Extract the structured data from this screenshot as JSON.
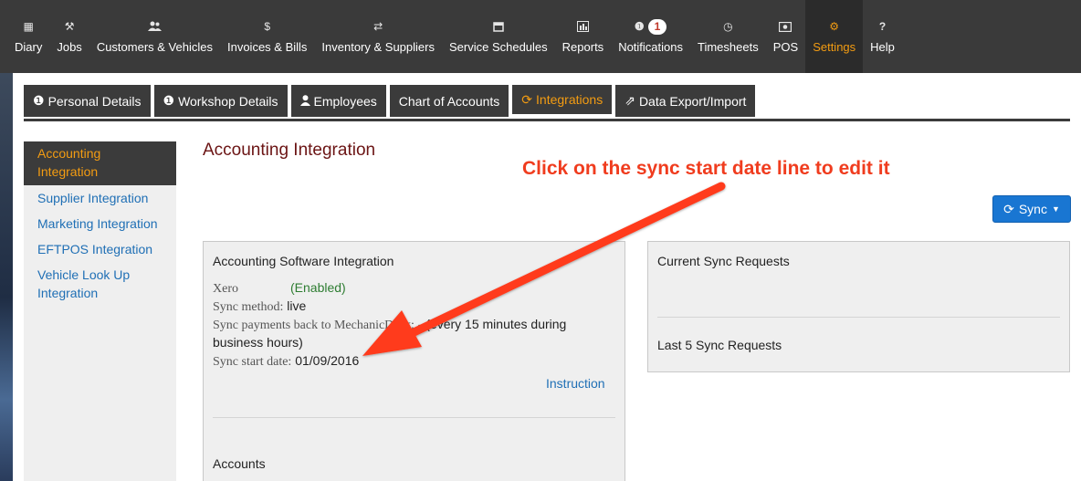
{
  "nav": {
    "items": [
      {
        "icon": "calendar-icon",
        "glyph": "▦",
        "label": "Diary"
      },
      {
        "icon": "wrench-icon",
        "glyph": "⚒",
        "label": "Jobs"
      },
      {
        "icon": "users-icon",
        "glyph": "👥",
        "label": "Customers & Vehicles"
      },
      {
        "icon": "dollar-icon",
        "glyph": "$",
        "label": "Invoices & Bills"
      },
      {
        "icon": "retweet-icon",
        "glyph": "⇄",
        "label": "Inventory & Suppliers"
      },
      {
        "icon": "calendar-blank-icon",
        "glyph": "▢",
        "label": "Service Schedules"
      },
      {
        "icon": "bar-chart-icon",
        "glyph": "▥",
        "label": "Reports"
      },
      {
        "icon": "info-icon",
        "glyph": "❶",
        "label": "Notifications",
        "badge": "1"
      },
      {
        "icon": "clock-icon",
        "glyph": "◷",
        "label": "Timesheets"
      },
      {
        "icon": "money-icon",
        "glyph": "▣",
        "label": "POS"
      },
      {
        "icon": "cogs-icon",
        "glyph": "⚙",
        "label": "Settings"
      },
      {
        "icon": "question-icon",
        "glyph": "?",
        "label": "Help"
      }
    ],
    "active": "Settings",
    "active_color": "#f39c12"
  },
  "tabs": [
    {
      "icon": "info-circle-icon",
      "glyph": "❶",
      "label": "Personal Details"
    },
    {
      "icon": "info-circle-icon",
      "glyph": "❶",
      "label": "Workshop Details"
    },
    {
      "icon": "user-icon",
      "glyph": "●",
      "label": "Employees"
    },
    {
      "icon": "",
      "glyph": "",
      "label": "Chart of Accounts"
    },
    {
      "icon": "refresh-icon",
      "glyph": "⟳",
      "label": "Integrations"
    },
    {
      "icon": "external-link-icon",
      "glyph": "⇗",
      "label": "Data Export/Import"
    }
  ],
  "side": {
    "items": [
      {
        "label": "Accounting Integration"
      },
      {
        "label": "Supplier Integration"
      },
      {
        "label": "Marketing Integration"
      },
      {
        "label": "EFTPOS Integration"
      },
      {
        "label": "Vehicle Look Up Integration"
      }
    ]
  },
  "main": {
    "title": "Accounting Integration",
    "sync_label": "Sync",
    "left_panel": {
      "title": "Accounting Software Integration",
      "provider": "Xero",
      "provider_status": "(Enabled)",
      "sync_method_label": "Sync method:",
      "sync_method_value": "live",
      "sync_payments_label": "Sync payments back to MechanicDesk:",
      "sync_payments_value": "- (every 15 minutes during",
      "sync_payments_value2": "business hours)",
      "start_date_label": "Sync start date:",
      "start_date_value": "01/09/2016",
      "instruction_link": "Instruction",
      "accounts_title": "Accounts"
    },
    "right_panel": {
      "current_title": "Current Sync Requests",
      "last_title": "Last 5 Sync Requests"
    }
  },
  "annotation": {
    "text": "Click on the sync start date line to edit it",
    "color": "#f03c1e"
  }
}
